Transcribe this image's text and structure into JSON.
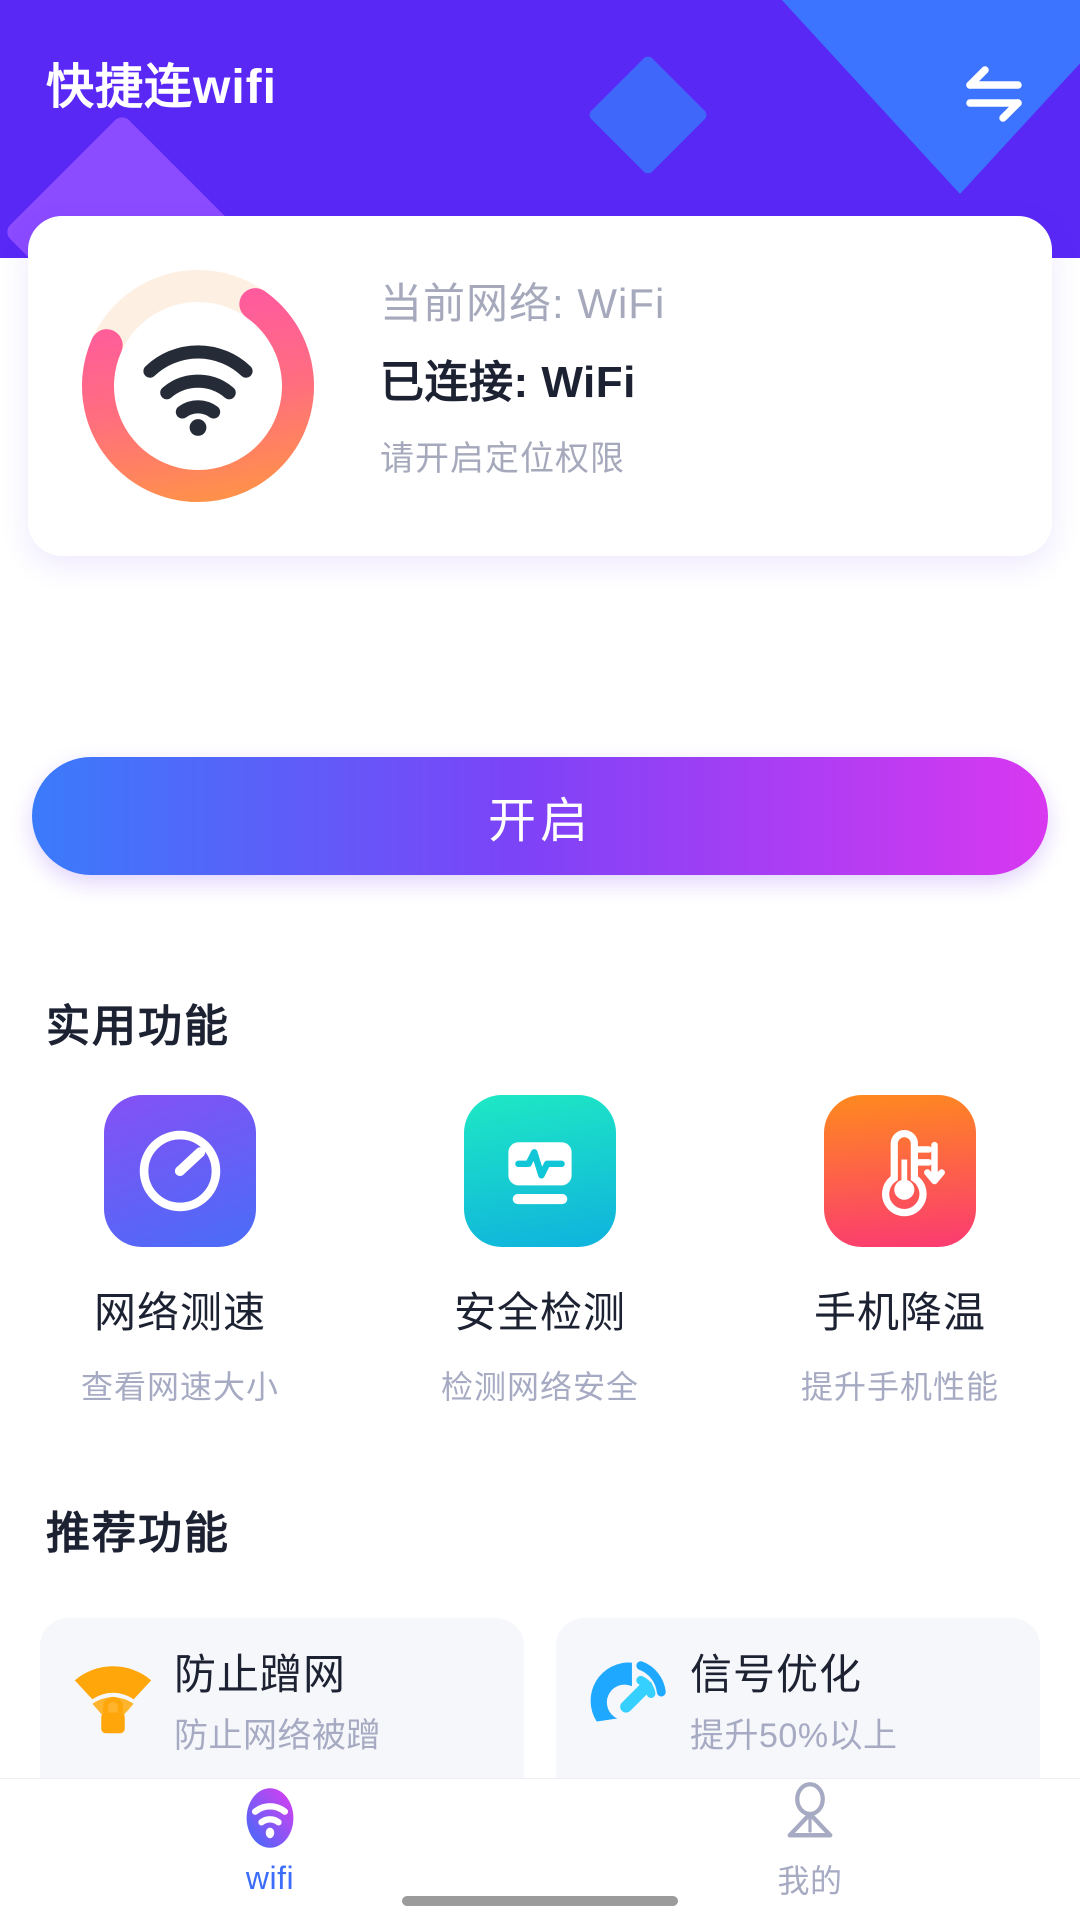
{
  "header": {
    "title": "快捷连wifi",
    "swap_icon": "swap-arrows-icon",
    "bg_color": "#5A28F5",
    "accent_color": "#3C73FF"
  },
  "status_card": {
    "ring": {
      "icon": "wifi-icon",
      "track_color": "#FDEFE2",
      "gradient_start": "#FF4FB0",
      "gradient_end": "#FF9A3C",
      "progress_percent": 72
    },
    "current_network_label": "当前网络: WiFi",
    "connected_label": "已连接: WiFi",
    "permission_hint": "请开启定位权限"
  },
  "primary_button": {
    "label": "开启",
    "gradient_start": "#3A7BFB",
    "gradient_end": "#D838F0"
  },
  "useful_section": {
    "title": "实用功能",
    "items": [
      {
        "label": "网络测速",
        "sub": "查看网速大小",
        "icon": "speedometer-icon",
        "color_start": "#8550F5",
        "color_end": "#4A6DF8"
      },
      {
        "label": "安全检测",
        "sub": "检测网络安全",
        "icon": "monitor-pulse-icon",
        "color_start": "#1EE8C4",
        "color_end": "#0FB2DD"
      },
      {
        "label": "手机降温",
        "sub": "提升手机性能",
        "icon": "thermometer-icon",
        "color_start": "#FF8A1E",
        "color_end": "#FB3A72"
      }
    ]
  },
  "recommend_section": {
    "title": "推荐功能",
    "items": [
      {
        "label": "防止蹭网",
        "sub": "防止网络被蹭",
        "icon": "wifi-lock-icon",
        "color": "#FFA60A"
      },
      {
        "label": "信号优化",
        "sub": "提升50%以上",
        "icon": "satellite-signal-icon",
        "color": "#1EA8FF"
      }
    ]
  },
  "bottom_nav": {
    "items": [
      {
        "label": "wifi",
        "icon": "wifi-nav-icon",
        "active": true
      },
      {
        "label": "我的",
        "icon": "user-profile-icon",
        "active": false
      }
    ],
    "active_color": "#3C6DFA",
    "inactive_color": "#A6AAC2"
  }
}
